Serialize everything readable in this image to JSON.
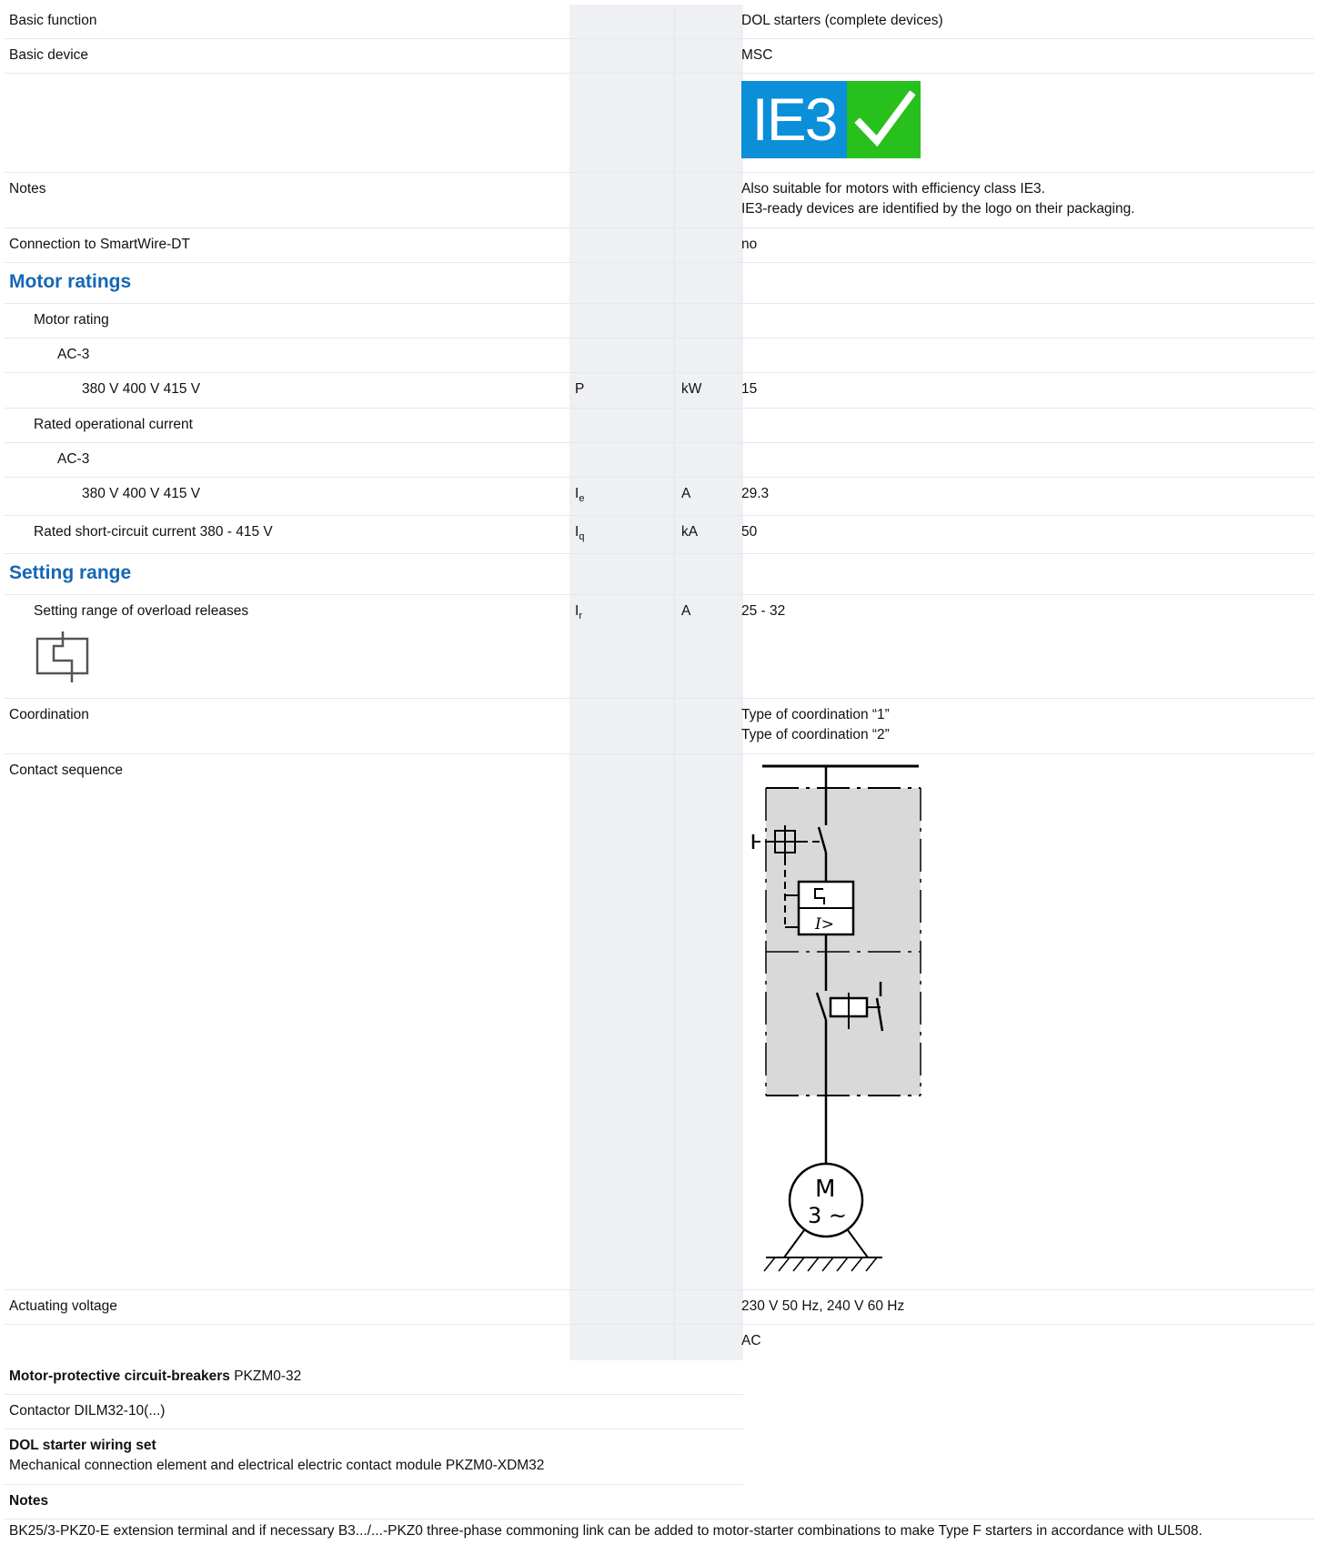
{
  "rows": {
    "basic_function": {
      "label": "Basic function",
      "value": "DOL starters (complete devices)"
    },
    "basic_device": {
      "label": "Basic device",
      "value": "MSC"
    },
    "ie3_logo": {
      "text": "IE3",
      "mark": "check-icon",
      "colors": {
        "left": "#0b8fd9",
        "right": "#27c01d"
      }
    },
    "notes": {
      "label": "Notes",
      "value_line1": "Also suitable for motors with efficiency class IE3.",
      "value_line2": "IE3-ready devices are identified by the logo on their packaging."
    },
    "smartwire": {
      "label": "Connection to SmartWire-DT",
      "value": "no"
    },
    "motor_ratings": {
      "heading": "Motor ratings"
    },
    "motor_rating": {
      "label": "Motor rating"
    },
    "ac3_a": {
      "label": "AC-3"
    },
    "voltage_p": {
      "label": "380 V 400 V 415 V",
      "symbol": "P",
      "unit": "kW",
      "value": "15"
    },
    "rated_current": {
      "label": "Rated operational current"
    },
    "ac3_b": {
      "label": "AC-3"
    },
    "voltage_i": {
      "label": "380 V 400 V 415 V",
      "symbol": "I",
      "symbol_sub": "e",
      "unit": "A",
      "value": "29.3"
    },
    "short_circuit": {
      "label": "Rated short-circuit current 380 - 415 V",
      "symbol": "I",
      "symbol_sub": "q",
      "unit": "kA",
      "value": "50"
    },
    "setting_range": {
      "heading": "Setting range"
    },
    "overload": {
      "label": "Setting range of overload releases",
      "symbol": "I",
      "symbol_sub": "r",
      "unit": "A",
      "value": "25 - 32",
      "icon": "overload-release-icon"
    },
    "coordination": {
      "label": "Coordination",
      "value_line1": "Type of coordination “1”",
      "value_line2": "Type of coordination “2”"
    },
    "contact_sequence": {
      "label": "Contact sequence",
      "diagram": {
        "overload_symbol": "I>",
        "motor_line1": "M",
        "motor_line2": "3 ~"
      }
    },
    "actuating_voltage": {
      "label": "Actuating voltage",
      "value": "230 V 50 Hz, 240 V 60 Hz"
    },
    "ac_row": {
      "value": "AC"
    }
  },
  "footer": {
    "mpcb": {
      "bold": "Motor-protective circuit-breakers",
      "text": " PKZM0-32"
    },
    "contactor": {
      "text": "Contactor DILM32-10(...)"
    },
    "wiring": {
      "bold": "DOL starter wiring set",
      "text": "Mechanical connection element and electrical electric contact module PKZM0-XDM32"
    },
    "notes_heading": "Notes",
    "notes_text": "BK25/3-PKZ0-E extension terminal and if necessary B3.../...-PKZ0 three-phase commoning link can be added to motor-starter combinations to make Type F starters in accordance with UL508."
  }
}
